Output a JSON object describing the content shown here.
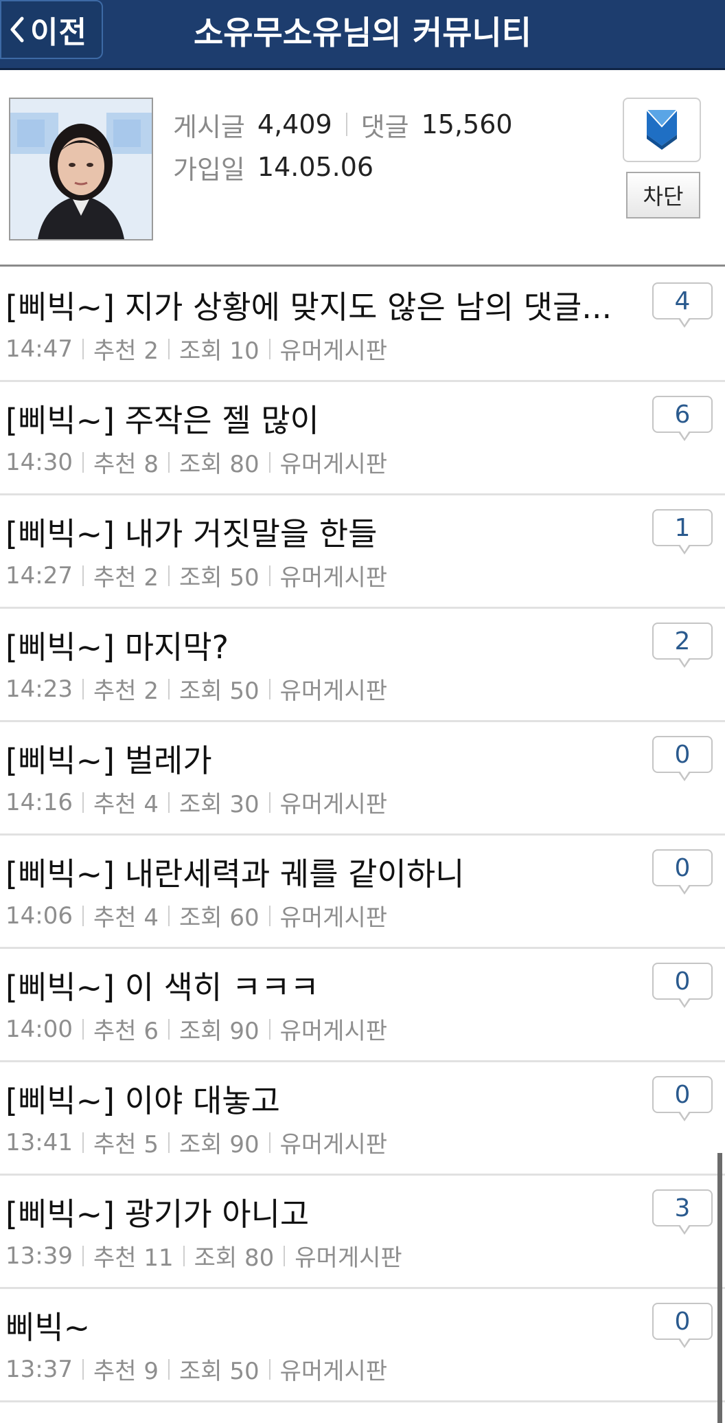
{
  "header": {
    "back_label": "이전",
    "title": "소유무소유님의 커뮤니티",
    "bg_color": "#1d3d6e"
  },
  "profile": {
    "posts_label": "게시글",
    "posts_count": "4,409",
    "comments_label": "댓글",
    "comments_count": "15,560",
    "joined_label": "가입일",
    "joined_date": "14.05.06",
    "block_label": "차단"
  },
  "posts": [
    {
      "title": "[삐빅~] 지가 상황에 맞지도 않은 남의 댓글...",
      "time": "14:47",
      "rec": "추천 2",
      "views": "조회 10",
      "board": "유머게시판",
      "comments": "4"
    },
    {
      "title": "[삐빅~] 주작은 젤 많이",
      "time": "14:30",
      "rec": "추천 8",
      "views": "조회 80",
      "board": "유머게시판",
      "comments": "6"
    },
    {
      "title": "[삐빅~] 내가 거짓말을 한들",
      "time": "14:27",
      "rec": "추천 2",
      "views": "조회 50",
      "board": "유머게시판",
      "comments": "1"
    },
    {
      "title": "[삐빅~] 마지막?",
      "time": "14:23",
      "rec": "추천 2",
      "views": "조회 50",
      "board": "유머게시판",
      "comments": "2"
    },
    {
      "title": "[삐빅~] 벌레가",
      "time": "14:16",
      "rec": "추천 4",
      "views": "조회 30",
      "board": "유머게시판",
      "comments": "0"
    },
    {
      "title": "[삐빅~] 내란세력과 궤를 같이하니",
      "time": "14:06",
      "rec": "추천 4",
      "views": "조회 60",
      "board": "유머게시판",
      "comments": "0"
    },
    {
      "title": "[삐빅~] 이 색히 ㅋㅋㅋ",
      "time": "14:00",
      "rec": "추천 6",
      "views": "조회 90",
      "board": "유머게시판",
      "comments": "0"
    },
    {
      "title": "[삐빅~] 이야 대놓고",
      "time": "13:41",
      "rec": "추천 5",
      "views": "조회 90",
      "board": "유머게시판",
      "comments": "0"
    },
    {
      "title": "[삐빅~] 광기가 아니고",
      "time": "13:39",
      "rec": "추천 11",
      "views": "조회 80",
      "board": "유머게시판",
      "comments": "3"
    },
    {
      "title": "삐빅~",
      "time": "13:37",
      "rec": "추천 9",
      "views": "조회 50",
      "board": "유머게시판",
      "comments": "0"
    }
  ]
}
